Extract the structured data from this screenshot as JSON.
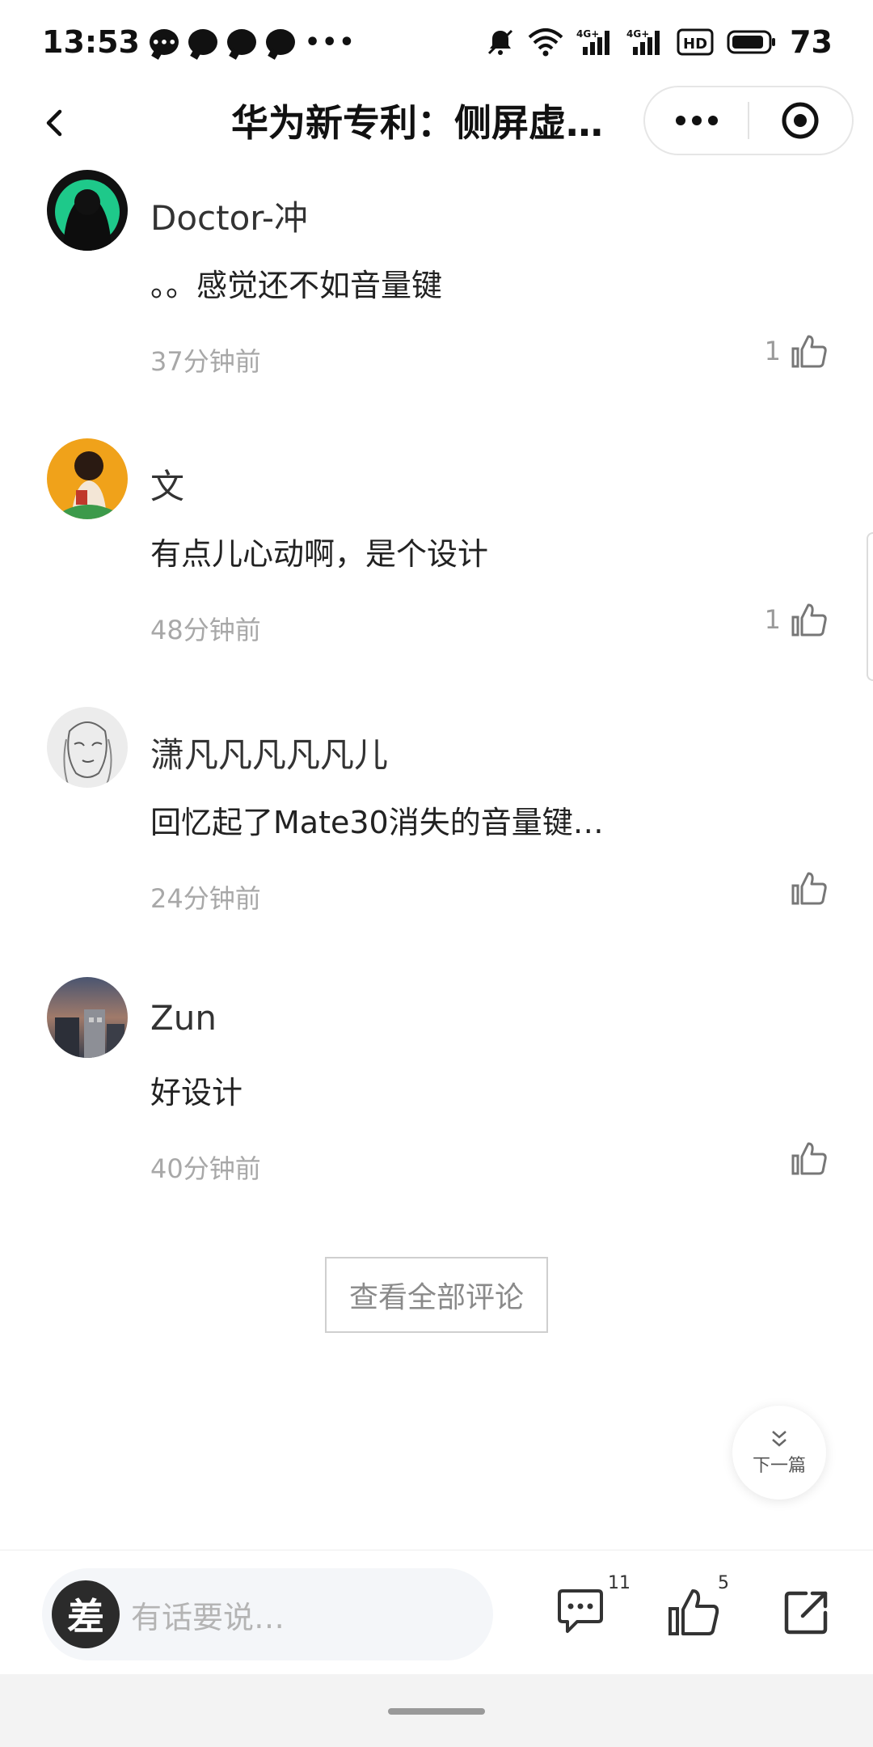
{
  "status_bar": {
    "time": "13:53",
    "battery": "73",
    "more": "•••",
    "icons": [
      "chat-app-icon",
      "message-icon",
      "message-icon",
      "message-icon",
      "silent-icon",
      "wifi-icon",
      "signal-4g-icon",
      "signal-4g-icon",
      "hd-icon",
      "battery-icon"
    ]
  },
  "nav": {
    "title": "华为新专利：侧屏虚…"
  },
  "comments": [
    {
      "name": "Doctor-冲",
      "text": "。。感觉还不如音量键",
      "time": "37分钟前",
      "likes": "1",
      "avatar_color": "#1ec98a"
    },
    {
      "name": "文",
      "text": "有点儿心动啊，是个设计",
      "time": "48分钟前",
      "likes": "1",
      "avatar_color": "#f0a21a"
    },
    {
      "name": "潇凡凡凡凡凡儿",
      "text": "回忆起了Mate30消失的音量键…",
      "time": "24分钟前",
      "likes": "",
      "avatar_color": "#dcdcdc"
    },
    {
      "name": "Zun",
      "text": "好设计",
      "time": "40分钟前",
      "likes": "",
      "avatar_color": "#5b6478"
    }
  ],
  "view_all": "查看全部评论",
  "next_article": "下一篇",
  "bottom_bar": {
    "user_avatar_char": "差",
    "placeholder": "有话要说…",
    "comment_count": "11",
    "like_count": "5"
  }
}
